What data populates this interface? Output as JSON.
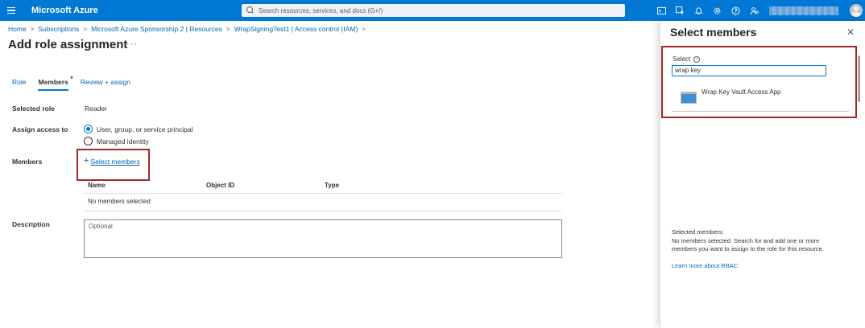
{
  "topbar": {
    "brand": "Microsoft Azure",
    "search_placeholder": "Search resources, services, and docs (G+/)",
    "icons": [
      "cloud-shell-icon",
      "directory-filter-icon",
      "notifications-icon",
      "settings-icon",
      "help-icon",
      "feedback-icon"
    ]
  },
  "breadcrumb": [
    "Home",
    "Subscriptions",
    "Microsoft Azure Sponsorship 2 | Resources",
    "WrapSigningTest1 | Access control (IAM)"
  ],
  "page": {
    "title": "Add role assignment",
    "more": "···"
  },
  "tabs": [
    {
      "label": "Role"
    },
    {
      "label": "Members",
      "required": "*"
    },
    {
      "label": "Review + assign"
    }
  ],
  "form": {
    "selected_role_label": "Selected role",
    "selected_role_value": "Reader",
    "assign_access_label": "Assign access to",
    "assign_options": [
      "User, group, or service principal",
      "Managed identity"
    ],
    "members_label": "Members",
    "select_members_plus": "+",
    "select_members_link": "Select members",
    "table_headers": [
      "Name",
      "Object ID",
      "Type"
    ],
    "no_members_text": "No members selected",
    "description_label": "Description",
    "description_placeholder": "Optional"
  },
  "panel": {
    "title": "Select members",
    "close": "✕",
    "select_label": "Select",
    "info": "i",
    "search_value": "wrap key",
    "result": "Wrap Key Vault Access App",
    "selected_heading": "Selected members:",
    "selected_text": "No members selected. Search for and add one or more members you want to assign to the role for this resource.",
    "learn_more": "Learn more about RBAC"
  },
  "colors": {
    "accent": "#0078d4",
    "link": "#0067b8",
    "highlight_box": "#a4262c"
  }
}
